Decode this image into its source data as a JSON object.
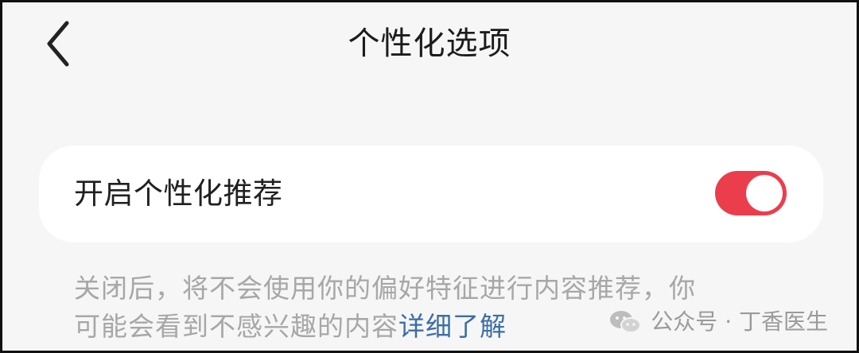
{
  "header": {
    "title": "个性化选项",
    "back_icon": "chevron-left-icon"
  },
  "setting": {
    "label": "开启个性化推荐",
    "toggle_on": true,
    "toggle_color": "#ec3d4d"
  },
  "description": {
    "line1": "关闭后，将不会使用你的偏好特征进行内容推荐，你",
    "line2_prefix": "可能会看到不感兴趣的内容",
    "link": "详细了解",
    "link_color": "#3c6ea7"
  },
  "watermark": {
    "icon": "wechat-icon",
    "text": "公众号 · 丁香医生"
  }
}
